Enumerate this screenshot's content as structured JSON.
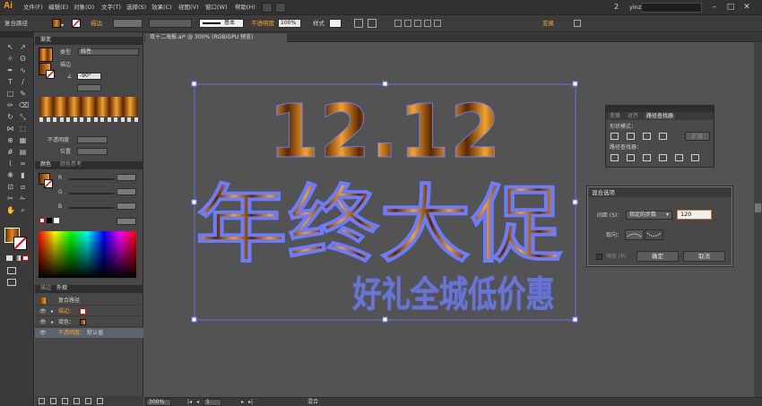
{
  "app": {
    "logo": "Ai",
    "brand_color": "#ff9a00"
  },
  "menu": [
    "文件(F)",
    "编辑(E)",
    "对象(O)",
    "文字(T)",
    "选择(S)",
    "效果(C)",
    "视图(V)",
    "窗口(W)",
    "帮助(H)"
  ],
  "user": {
    "count": "2",
    "name": "yinzi"
  },
  "control_bar": {
    "selection_label": "复合路径",
    "stroke_label": "描边",
    "stroke_style": "基本",
    "opacity_label": "不透明度",
    "opacity_value": "100%",
    "style_label": "样式",
    "transform_label": "变换"
  },
  "gradient_panel": {
    "tab": "渐变",
    "type_label": "类型",
    "type_value": "线性",
    "stroke_label": "描边",
    "angle_value": "-90°",
    "opacity_label": "不透明度",
    "location_label": "位置"
  },
  "color_panel": {
    "tabs": [
      "颜色",
      "颜色参考"
    ],
    "channels": [
      "R",
      "G",
      "B"
    ]
  },
  "layers_panel": {
    "tabs": [
      "描边",
      "外观"
    ],
    "rows": [
      {
        "label": "复合路径"
      },
      {
        "label": "描边：",
        "orange": true
      },
      {
        "label": "填色："
      },
      {
        "label": "不透明度：",
        "value": "默认值",
        "orange": true
      }
    ]
  },
  "document": {
    "tab_title": "双十二海报.ai* @ 300% (RGB/GPU 预览)",
    "art_line1": "12.12",
    "art_line2": "年终大促",
    "art_line3": "好礼全城低价惠"
  },
  "pathfinder": {
    "tabs": [
      "变换",
      "对齐",
      "路径查找器"
    ],
    "shape_modes_label": "形状模式：",
    "pathfinders_label": "路径查找器：",
    "expand_label": "扩展"
  },
  "blend_dialog": {
    "title": "混合选项",
    "spacing_label": "间距 (S)：",
    "spacing_value": "指定的步数",
    "steps_value": "120",
    "orientation_label": "取向：",
    "preview_label": "预览 (P)",
    "ok_label": "确定",
    "cancel_label": "取消"
  },
  "status": {
    "zoom": "300%",
    "page": "1",
    "mode": "混合"
  }
}
